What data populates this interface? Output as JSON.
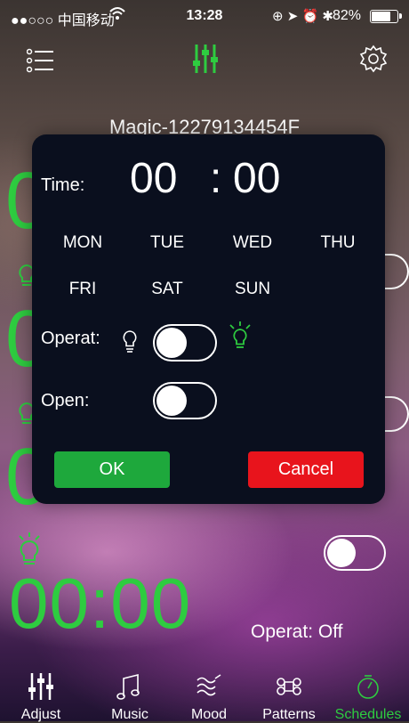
{
  "status_bar": {
    "carrier": "●●○○○ 中国移动",
    "time": "13:28",
    "battery": "82%",
    "battery_level": 0.82
  },
  "header": {
    "icons": [
      "menu-icon",
      "sliders-icon",
      "gear-icon"
    ],
    "device_name": "Magic-12279134454F"
  },
  "background": {
    "big_time": "00:00",
    "operat_status": "Operat:  Off"
  },
  "dialog": {
    "time_label": "Time:",
    "hour": "00",
    "colon": ":",
    "minute": "00",
    "days_row1": [
      "MON",
      "TUE",
      "WED",
      "THU"
    ],
    "days_row2": [
      "FRI",
      "SAT",
      "SUN"
    ],
    "operat_label": "Operat:",
    "operat_on": false,
    "open_label": "Open:",
    "open_on": false,
    "ok_label": "OK",
    "cancel_label": "Cancel"
  },
  "tabs": [
    {
      "label": "Adjust",
      "icon": "sliders-icon",
      "active": false
    },
    {
      "label": "Music",
      "icon": "music-note-icon",
      "active": false
    },
    {
      "label": "Mood",
      "icon": "mood-waves-icon",
      "active": false
    },
    {
      "label": "Patterns",
      "icon": "command-icon",
      "active": false
    },
    {
      "label": "Schedules",
      "icon": "timer-icon",
      "active": true
    }
  ],
  "colors": {
    "accent_green": "#2ecc40",
    "ok_green": "#1ea83c",
    "cancel_red": "#e8141c",
    "dialog_bg": "#0a0f1e"
  }
}
